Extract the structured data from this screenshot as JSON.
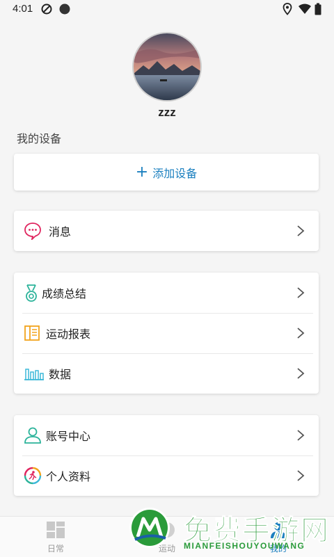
{
  "status_bar": {
    "time": "4:01"
  },
  "profile": {
    "username": "zzz"
  },
  "devices": {
    "section_title": "我的设备",
    "add_label": "添加设备"
  },
  "menu_groups": [
    {
      "items": [
        {
          "label": "消息",
          "icon": "message-icon"
        }
      ]
    },
    {
      "items": [
        {
          "label": "成绩总结",
          "icon": "medal-icon"
        },
        {
          "label": "运动报表",
          "icon": "report-book-icon"
        },
        {
          "label": "数据",
          "icon": "bar-chart-icon"
        }
      ]
    },
    {
      "items": [
        {
          "label": "账号中心",
          "icon": "user-icon"
        },
        {
          "label": "个人资料",
          "icon": "profile-runner-icon"
        }
      ]
    }
  ],
  "bottom_nav": [
    {
      "label": "日常",
      "icon": "dashboard-icon"
    },
    {
      "label": "运动",
      "icon": "sport-icon"
    },
    {
      "label": "我的",
      "icon": "me-icon"
    }
  ],
  "watermark": {
    "title": "免费手游网",
    "subtitle": "MIANFEISHOUYOUWANG"
  },
  "colors": {
    "accent_blue": "#1a7fbf",
    "message_icon": "#e0245e",
    "medal_icon": "#2bb39a",
    "report_icon": "#f2a31b",
    "chart_icon": "#3cb8d8",
    "user_icon": "#2bb39a",
    "watermark_green": "#2a9b3a"
  }
}
